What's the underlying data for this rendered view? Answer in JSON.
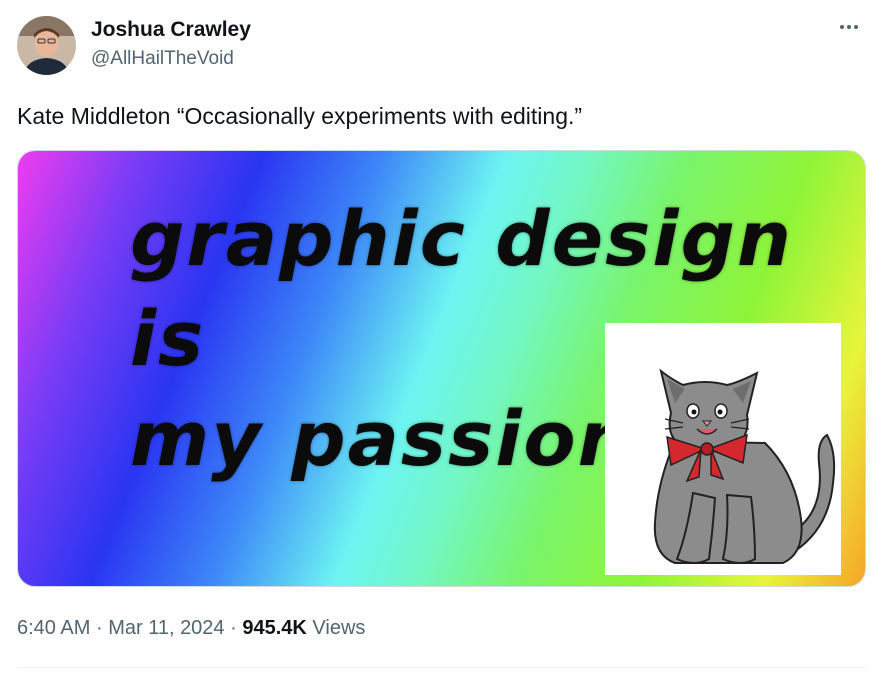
{
  "author": {
    "display_name": "Joshua Crawley",
    "handle": "@AllHailTheVoid"
  },
  "tweet": {
    "text": "Kate Middleton “Occasionally experiments with editing.”"
  },
  "media": {
    "meme_text": "graphic design is\nmy passion.",
    "description_icons": [
      "rainbow-gradient-background",
      "cat-with-bow-icon"
    ]
  },
  "meta": {
    "time": "6:40 AM",
    "separator": "·",
    "date": "Mar 11, 2024",
    "views_count": "945.4K",
    "views_label": "Views"
  },
  "colors": {
    "text_primary": "#0f1419",
    "text_secondary": "#536471",
    "divider": "#eff3f4"
  }
}
